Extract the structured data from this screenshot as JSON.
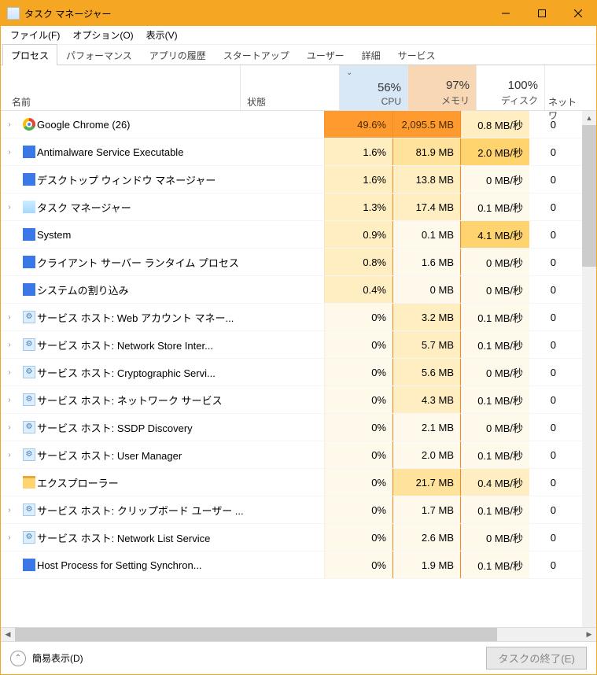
{
  "window": {
    "title": "タスク マネージャー"
  },
  "menu": {
    "file": "ファイル(F)",
    "options": "オプション(O)",
    "view": "表示(V)"
  },
  "tabs": {
    "processes": "プロセス",
    "performance": "パフォーマンス",
    "app_history": "アプリの履歴",
    "startup": "スタートアップ",
    "users": "ユーザー",
    "details": "詳細",
    "services": "サービス"
  },
  "columns": {
    "name": "名前",
    "status": "状態",
    "cpu_pct": "56%",
    "cpu_label": "CPU",
    "mem_pct": "97%",
    "mem_label": "メモリ",
    "disk_pct": "100%",
    "disk_label": "ディスク",
    "net_label": "ネットワ"
  },
  "rows": [
    {
      "expand": true,
      "icon": "chrome",
      "name": "Google Chrome (26)",
      "cpu": "49.6%",
      "cpu_h": 5,
      "mem": "2,095.5 MB",
      "mem_h": 5,
      "disk": "0.8 MB/秒",
      "disk_h": 1,
      "net": "0"
    },
    {
      "expand": true,
      "icon": "win",
      "name": "Antimalware Service Executable",
      "cpu": "1.6%",
      "cpu_h": 1,
      "mem": "81.9 MB",
      "mem_h": 2,
      "disk": "2.0 MB/秒",
      "disk_h": 3,
      "net": "0"
    },
    {
      "expand": false,
      "icon": "win",
      "name": "デスクトップ ウィンドウ マネージャー",
      "cpu": "1.6%",
      "cpu_h": 1,
      "mem": "13.8 MB",
      "mem_h": 1,
      "disk": "0 MB/秒",
      "disk_h": 0,
      "net": "0"
    },
    {
      "expand": true,
      "icon": "tm",
      "name": "タスク マネージャー",
      "cpu": "1.3%",
      "cpu_h": 1,
      "mem": "17.4 MB",
      "mem_h": 1,
      "disk": "0.1 MB/秒",
      "disk_h": 0,
      "net": "0"
    },
    {
      "expand": false,
      "icon": "win",
      "name": "System",
      "cpu": "0.9%",
      "cpu_h": 1,
      "mem": "0.1 MB",
      "mem_h": 0,
      "disk": "4.1 MB/秒",
      "disk_h": 3,
      "net": "0"
    },
    {
      "expand": false,
      "icon": "win",
      "name": "クライアント サーバー ランタイム プロセス",
      "cpu": "0.8%",
      "cpu_h": 1,
      "mem": "1.6 MB",
      "mem_h": 0,
      "disk": "0 MB/秒",
      "disk_h": 0,
      "net": "0"
    },
    {
      "expand": false,
      "icon": "win",
      "name": "システムの割り込み",
      "cpu": "0.4%",
      "cpu_h": 1,
      "mem": "0 MB",
      "mem_h": 0,
      "disk": "0 MB/秒",
      "disk_h": 0,
      "net": "0"
    },
    {
      "expand": true,
      "icon": "svc",
      "name": "サービス ホスト: Web アカウント マネー...",
      "cpu": "0%",
      "cpu_h": 0,
      "mem": "3.2 MB",
      "mem_h": 1,
      "disk": "0.1 MB/秒",
      "disk_h": 0,
      "net": "0"
    },
    {
      "expand": true,
      "icon": "svc",
      "name": "サービス ホスト: Network Store Inter...",
      "cpu": "0%",
      "cpu_h": 0,
      "mem": "5.7 MB",
      "mem_h": 1,
      "disk": "0.1 MB/秒",
      "disk_h": 0,
      "net": "0"
    },
    {
      "expand": true,
      "icon": "svc",
      "name": "サービス ホスト: Cryptographic Servi...",
      "cpu": "0%",
      "cpu_h": 0,
      "mem": "5.6 MB",
      "mem_h": 1,
      "disk": "0 MB/秒",
      "disk_h": 0,
      "net": "0"
    },
    {
      "expand": true,
      "icon": "svc",
      "name": "サービス ホスト: ネットワーク サービス",
      "cpu": "0%",
      "cpu_h": 0,
      "mem": "4.3 MB",
      "mem_h": 1,
      "disk": "0.1 MB/秒",
      "disk_h": 0,
      "net": "0"
    },
    {
      "expand": true,
      "icon": "svc",
      "name": "サービス ホスト: SSDP Discovery",
      "cpu": "0%",
      "cpu_h": 0,
      "mem": "2.1 MB",
      "mem_h": 0,
      "disk": "0 MB/秒",
      "disk_h": 0,
      "net": "0"
    },
    {
      "expand": true,
      "icon": "svc",
      "name": "サービス ホスト: User Manager",
      "cpu": "0%",
      "cpu_h": 0,
      "mem": "2.0 MB",
      "mem_h": 0,
      "disk": "0.1 MB/秒",
      "disk_h": 0,
      "net": "0"
    },
    {
      "expand": false,
      "icon": "exp",
      "name": "エクスプローラー",
      "cpu": "0%",
      "cpu_h": 0,
      "mem": "21.7 MB",
      "mem_h": 2,
      "disk": "0.4 MB/秒",
      "disk_h": 1,
      "net": "0"
    },
    {
      "expand": true,
      "icon": "svc",
      "name": "サービス ホスト: クリップボード ユーザー ...",
      "cpu": "0%",
      "cpu_h": 0,
      "mem": "1.7 MB",
      "mem_h": 0,
      "disk": "0.1 MB/秒",
      "disk_h": 0,
      "net": "0"
    },
    {
      "expand": true,
      "icon": "svc",
      "name": "サービス ホスト: Network List Service",
      "cpu": "0%",
      "cpu_h": 0,
      "mem": "2.6 MB",
      "mem_h": 0,
      "disk": "0 MB/秒",
      "disk_h": 0,
      "net": "0"
    },
    {
      "expand": false,
      "icon": "win",
      "name": "Host Process for Setting Synchron...",
      "cpu": "0%",
      "cpu_h": 0,
      "mem": "1.9 MB",
      "mem_h": 0,
      "disk": "0.1 MB/秒",
      "disk_h": 0,
      "net": "0"
    }
  ],
  "footer": {
    "fewer_details": "簡易表示(D)",
    "end_task": "タスクの終了(E)"
  }
}
